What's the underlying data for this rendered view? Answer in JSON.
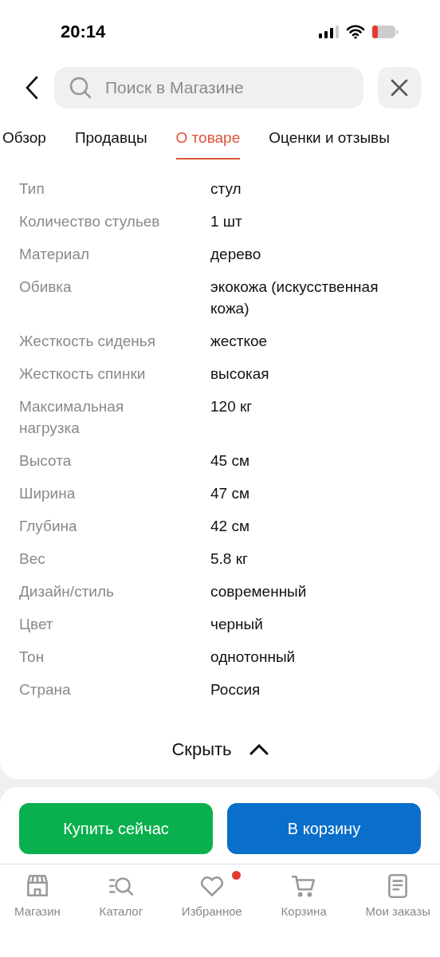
{
  "status_bar": {
    "time": "20:14"
  },
  "search": {
    "placeholder": "Поиск в Магазине"
  },
  "tabs": [
    {
      "label": "Обзор",
      "selected": false
    },
    {
      "label": "Продавцы",
      "selected": false
    },
    {
      "label": "О товаре",
      "selected": true
    },
    {
      "label": "Оценки и отзывы",
      "selected": false
    }
  ],
  "specs": [
    {
      "name": "Тип",
      "value": "стул"
    },
    {
      "name": "Количество стульев",
      "value": "1 шт"
    },
    {
      "name": "Материал",
      "value": "дерево"
    },
    {
      "name": "Обивка",
      "value": "экокожа (искусственная кожа)"
    },
    {
      "name": "Жесткость сиденья",
      "value": "жесткое"
    },
    {
      "name": "Жесткость спинки",
      "value": "высокая"
    },
    {
      "name": "Максимальная нагрузка",
      "value": "120 кг"
    },
    {
      "name": "Высота",
      "value": "45 см"
    },
    {
      "name": "Ширина",
      "value": "47 см"
    },
    {
      "name": "Глубина",
      "value": "42 см"
    },
    {
      "name": "Вес",
      "value": "5.8 кг"
    },
    {
      "name": "Дизайн/стиль",
      "value": "современный"
    },
    {
      "name": "Цвет",
      "value": "черный"
    },
    {
      "name": "Тон",
      "value": "однотонный"
    },
    {
      "name": "Страна",
      "value": "Россия"
    }
  ],
  "collapse_label": "Скрыть",
  "actions": [
    {
      "kind": "buy",
      "label": "Купить сейчас"
    },
    {
      "kind": "cart",
      "label": "В корзину"
    }
  ],
  "bottom_nav": [
    {
      "kind": "shop",
      "label": "Магазин",
      "badge": false
    },
    {
      "kind": "catalog",
      "label": "Каталог",
      "badge": false
    },
    {
      "kind": "favorites",
      "label": "Избранное",
      "badge": true
    },
    {
      "kind": "cart",
      "label": "Корзина",
      "badge": false
    },
    {
      "kind": "orders",
      "label": "Мои заказы",
      "badge": false
    }
  ]
}
